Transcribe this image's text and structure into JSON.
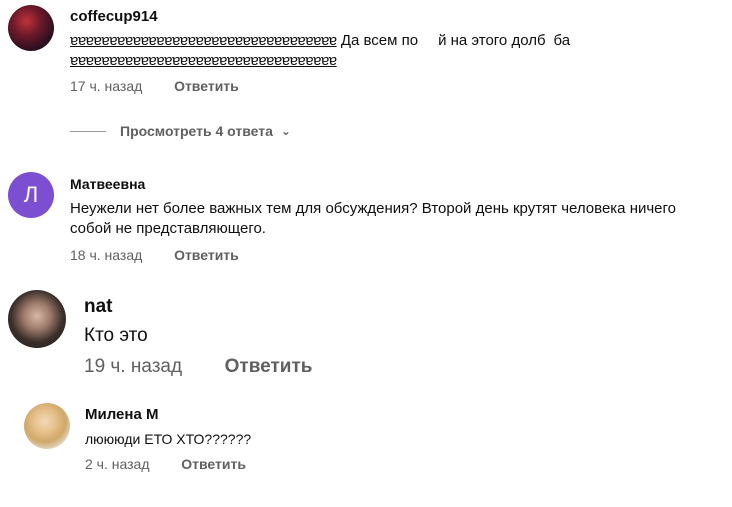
{
  "comments": [
    {
      "author": "coffecup914",
      "garble_1": "ɐɐɐɐɐɐɐɐɐɐɐɐɐɐɐɐɐɐɐɐɐɐɐɐɐɐɐɐɐɐɐɐɐɐ",
      "text_a": "Да всем по",
      "text_b": "й на этого долб",
      "text_c": "ба",
      "garble_2": "ɐɐɐɐɐɐɐɐɐɐɐɐɐɐɐɐɐɐɐɐɐɐɐɐɐɐɐɐɐɐɐɐɐɐ",
      "time": "17 ч. назад",
      "reply": "Ответить"
    },
    {
      "author": "Матвеевна",
      "avatar_letter": "Л",
      "text": "Неужели нет более важных тем для обсуждения? Второй день крутят человека ничего собой не представляющего.",
      "time": "18 ч. назад",
      "reply": "Ответить"
    },
    {
      "author": "nat",
      "text": "Кто это",
      "time": "19 ч. назад",
      "reply": "Ответить"
    },
    {
      "author": "Милена М",
      "text": "люююди ЕТО ХТО??????",
      "time": "2 ч. назад",
      "reply": "Ответить"
    }
  ],
  "replies_toggle": "Просмотреть 4 ответа",
  "colors": {
    "avatar_letter_bg": "#7c4ed1",
    "meta": "#606060"
  }
}
